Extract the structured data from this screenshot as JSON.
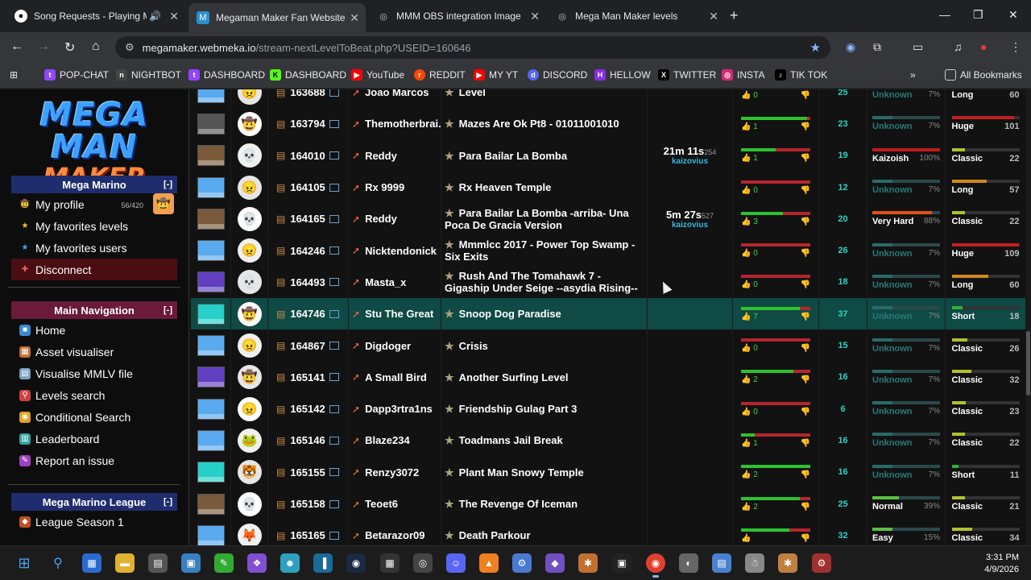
{
  "browser": {
    "tabs": [
      {
        "title": "Song Requests - Playing Mu",
        "icon": "github-icon",
        "audio": true
      },
      {
        "title": "Megaman Maker Fan Website",
        "icon": "megaman-icon",
        "active": true
      },
      {
        "title": "MMM OBS integration Image",
        "icon": "globe-icon"
      },
      {
        "title": "Mega Man Maker levels",
        "icon": "globe-icon"
      }
    ],
    "url_host": "megamaker.webmeka.io",
    "url_path": "/stream-nextLevelToBeat.php?USEID=160646",
    "bookmarks": [
      "POP-CHAT",
      "NIGHTBOT",
      "DASHBOARD",
      "DASHBOARD",
      "YouTube",
      "REDDIT",
      "MY YT",
      "DISCORD",
      "HELLOW",
      "TWITTER",
      "INSTA",
      "TIK TOK"
    ],
    "all_bookmarks": "All Bookmarks"
  },
  "sidebar": {
    "logo_line1": "MEGA MAN",
    "logo_line2": "MAKER",
    "user_section": {
      "title": "Mega Marino",
      "toggle": "[-]"
    },
    "user_items": [
      {
        "label": "My profile",
        "count": "56/420"
      },
      {
        "label": "My favorites levels"
      },
      {
        "label": "My favorites users"
      },
      {
        "label": "Disconnect"
      }
    ],
    "nav_section": {
      "title": "Main Navigation",
      "toggle": "[-]"
    },
    "nav_items": [
      "Home",
      "Asset visualiser",
      "Visualise MMLV file",
      "Levels search",
      "Conditional Search",
      "Leaderboard",
      "Report an issue"
    ],
    "league_section": {
      "title": "Mega Marino League",
      "toggle": "[-]"
    },
    "league_items": [
      "League Season 1"
    ]
  },
  "levels": [
    {
      "id": "163688",
      "user": "Joao Marcos",
      "title": "Level",
      "time": "",
      "kaizo": "",
      "up": 0,
      "down": "",
      "vote_pct": 0.5,
      "plays": "25",
      "diff": "Unknown",
      "diff_pct": "7%",
      "length": "Long",
      "len_n": "60",
      "thumb": "",
      "avatar": "😠"
    },
    {
      "id": "163794",
      "user": "Themotherbrai...",
      "title": "Mazes Are Ok Pt8 - 01011001010",
      "time": "",
      "kaizo": "",
      "up": 1,
      "down": "",
      "vote_pct": 0.95,
      "plays": "23",
      "diff": "Unknown",
      "diff_pct": "7%",
      "length": "Huge",
      "len_n": "101",
      "thumb": "dark",
      "avatar": "🤠"
    },
    {
      "id": "164010",
      "user": "Reddy",
      "title": "Para Bailar La Bomba",
      "time": "21m 11s",
      "time_sub": "254",
      "kaizo": "kaizovius",
      "up": 1,
      "down": "",
      "vote_pct": 0.5,
      "plays": "19",
      "diff": "Kaizoish",
      "diff_pct": "100%",
      "length": "Classic",
      "len_n": "22",
      "thumb": "brown",
      "avatar": "💀"
    },
    {
      "id": "164105",
      "user": "Rx 9999",
      "title": "Rx Heaven Temple",
      "time": "",
      "kaizo": "",
      "up": 0,
      "down": "",
      "vote_pct": 0.0,
      "plays": "12",
      "diff": "Unknown",
      "diff_pct": "7%",
      "length": "Long",
      "len_n": "57",
      "thumb": "",
      "avatar": "😠"
    },
    {
      "id": "164165",
      "user": "Reddy",
      "title": "Para Bailar La Bomba -arriba- Una Poca De Gracia Version",
      "time": "5m 27s",
      "time_sub": "527",
      "kaizo": "kaizovius",
      "up": 3,
      "down": "",
      "vote_pct": 0.6,
      "plays": "20",
      "diff": "Very Hard",
      "diff_pct": "88%",
      "length": "Classic",
      "len_n": "22",
      "thumb": "brown",
      "avatar": "💀"
    },
    {
      "id": "164246",
      "user": "Nicktendonick",
      "title": "Mmmlcc 2017 - Power Top Swamp - Six Exits",
      "time": "",
      "kaizo": "",
      "up": 0,
      "down": "",
      "vote_pct": 0.0,
      "plays": "26",
      "diff": "Unknown",
      "diff_pct": "7%",
      "length": "Huge",
      "len_n": "109",
      "thumb": "",
      "avatar": "😠"
    },
    {
      "id": "164493",
      "user": "Masta_x",
      "title": "Rush And The Tomahawk 7 - Gigaship Under Seige --asydia Rising--",
      "time": "",
      "kaizo": "",
      "up": 0,
      "down": "",
      "vote_pct": 0.0,
      "plays": "18",
      "diff": "Unknown",
      "diff_pct": "7%",
      "length": "Long",
      "len_n": "60",
      "thumb": "purple",
      "avatar": "💀"
    },
    {
      "id": "164746",
      "user": "Stu The Great",
      "title": "Snoop Dog Paradise",
      "time": "",
      "kaizo": "",
      "up": 7,
      "down": "",
      "vote_pct": 0.85,
      "plays": "37",
      "diff": "Unknown",
      "diff_pct": "7%",
      "length": "Short",
      "len_n": "18",
      "thumb": "teal",
      "avatar": "🤠",
      "highlight": true
    },
    {
      "id": "164867",
      "user": "Digdoger",
      "title": "Crisis",
      "time": "",
      "kaizo": "",
      "up": 0,
      "down": "",
      "vote_pct": 0.0,
      "plays": "15",
      "diff": "Unknown",
      "diff_pct": "7%",
      "length": "Classic",
      "len_n": "26",
      "thumb": "",
      "avatar": "😠"
    },
    {
      "id": "165141",
      "user": "A Small Bird",
      "title": "Another Surfing Level",
      "time": "",
      "kaizo": "",
      "up": 2,
      "down": "",
      "vote_pct": 0.75,
      "plays": "16",
      "diff": "Unknown",
      "diff_pct": "7%",
      "length": "Classic",
      "len_n": "32",
      "thumb": "purple",
      "avatar": "🤠"
    },
    {
      "id": "165142",
      "user": "Dapp3rtra1ns",
      "title": "Friendship Gulag Part 3",
      "time": "",
      "kaizo": "",
      "up": 0,
      "down": "",
      "vote_pct": 0.0,
      "plays": "6",
      "diff": "Unknown",
      "diff_pct": "7%",
      "length": "Classic",
      "len_n": "23",
      "thumb": "",
      "avatar": "😠"
    },
    {
      "id": "165146",
      "user": "Blaze234",
      "title": "Toadmans Jail Break",
      "time": "",
      "kaizo": "",
      "up": 1,
      "down": "",
      "vote_pct": 0.2,
      "plays": "16",
      "diff": "Unknown",
      "diff_pct": "7%",
      "length": "Classic",
      "len_n": "22",
      "thumb": "",
      "avatar": "🐸"
    },
    {
      "id": "165155",
      "user": "Renzy3072",
      "title": "Plant Man Snowy Temple",
      "time": "",
      "kaizo": "",
      "up": 2,
      "down": "",
      "vote_pct": 1.0,
      "plays": "16",
      "diff": "Unknown",
      "diff_pct": "7%",
      "length": "Short",
      "len_n": "11",
      "thumb": "teal",
      "avatar": "🐯"
    },
    {
      "id": "165158",
      "user": "Teoet6",
      "title": "The Revenge Of Iceman",
      "time": "",
      "kaizo": "",
      "up": 2,
      "down": "",
      "vote_pct": 0.85,
      "plays": "25",
      "diff": "Normal",
      "diff_pct": "39%",
      "length": "Classic",
      "len_n": "21",
      "thumb": "brown",
      "avatar": "💀"
    },
    {
      "id": "165165",
      "user": "Betarazor09",
      "title": "Death Parkour",
      "time": "",
      "kaizo": "",
      "up": "",
      "down": "",
      "vote_pct": 0.7,
      "plays": "32",
      "diff": "Easy",
      "diff_pct": "15%",
      "length": "Classic",
      "len_n": "34",
      "thumb": "",
      "avatar": "🦊"
    }
  ],
  "colors": {
    "diff_unknown": "#2a6a6a",
    "diff_kaizo": "#c01a1a",
    "diff_veryhard": "#e0501a",
    "diff_normal": "#5ac040",
    "len_long": "#d08a20",
    "len_huge": "#c02020",
    "len_classic": "#b0c030",
    "len_short": "#30b030"
  },
  "taskbar": {
    "time": "3:31 PM",
    "date": "4/9/2026"
  }
}
